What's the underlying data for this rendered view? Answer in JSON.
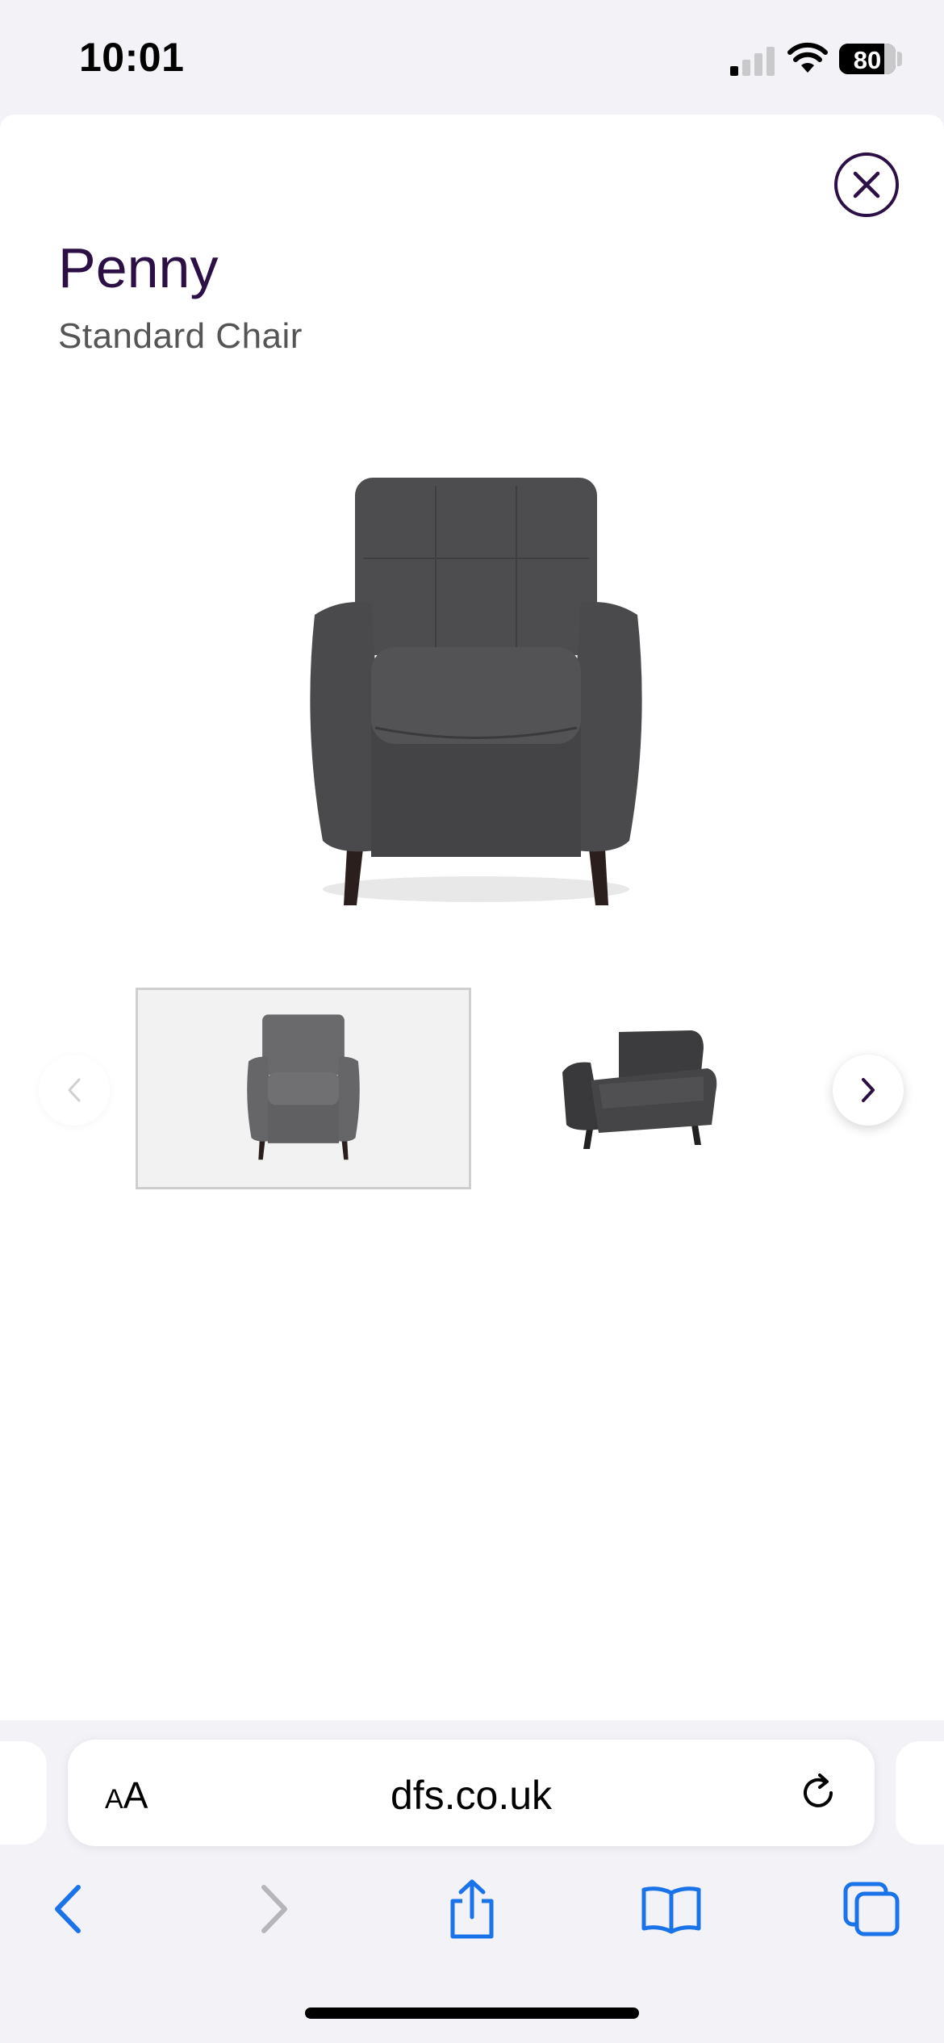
{
  "status_bar": {
    "time": "10:01",
    "battery_percent": "80"
  },
  "product": {
    "title": "Penny",
    "subtitle": "Standard Chair"
  },
  "gallery": {
    "selected_index": 0,
    "thumbnails": [
      {
        "icon": "chair-front-thumbnail"
      },
      {
        "icon": "chair-angle-thumbnail"
      }
    ]
  },
  "browser": {
    "text_size_label_small": "A",
    "text_size_label_large": "A",
    "url": "dfs.co.uk"
  },
  "colors": {
    "brand_purple": "#2b0f45",
    "ios_blue": "#1a73e8",
    "chair_fabric": "#4a4a4c"
  }
}
